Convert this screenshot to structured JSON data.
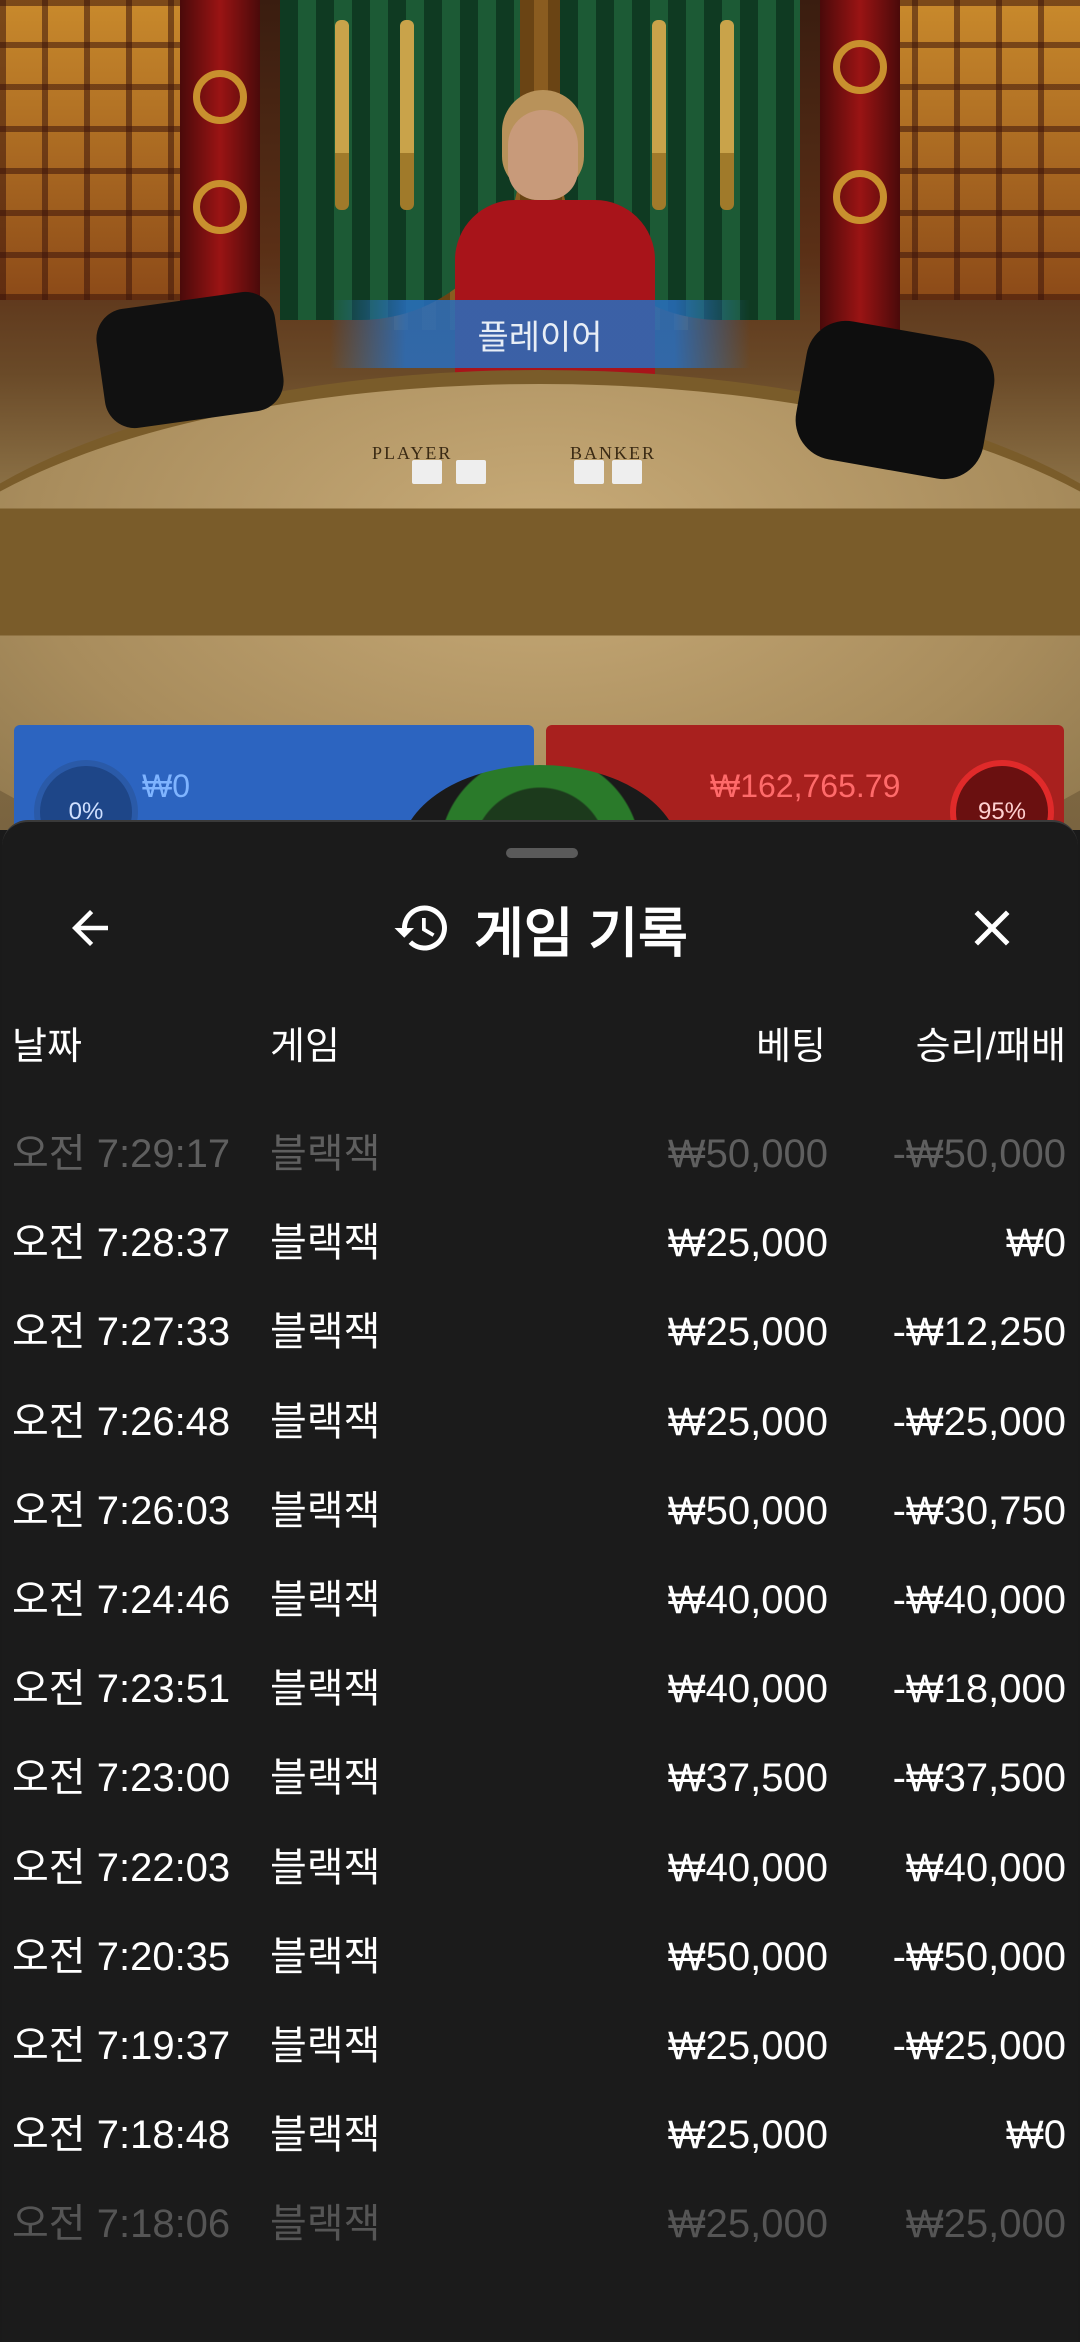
{
  "video": {
    "banner_label": "플레이어",
    "table_left_label": "PLAYER",
    "table_right_label": "BANKER",
    "player_percent": "0%",
    "player_amount": "₩0",
    "banker_amount": "₩162,765.79",
    "banker_percent": "95%"
  },
  "sheet": {
    "title": "게임 기록",
    "title_icon": "history-icon",
    "back_icon": "arrow-left-icon",
    "close_icon": "close-icon",
    "columns": {
      "date": "날짜",
      "game": "게임",
      "bet": "베팅",
      "result": "승리/패배"
    },
    "rows": [
      {
        "date": "오전 7:29:17",
        "game": "블랙잭",
        "bet": "₩50,000",
        "result": "-₩50,000"
      },
      {
        "date": "오전 7:28:37",
        "game": "블랙잭",
        "bet": "₩25,000",
        "result": "₩0"
      },
      {
        "date": "오전 7:27:33",
        "game": "블랙잭",
        "bet": "₩25,000",
        "result": "-₩12,250"
      },
      {
        "date": "오전 7:26:48",
        "game": "블랙잭",
        "bet": "₩25,000",
        "result": "-₩25,000"
      },
      {
        "date": "오전 7:26:03",
        "game": "블랙잭",
        "bet": "₩50,000",
        "result": "-₩30,750"
      },
      {
        "date": "오전 7:24:46",
        "game": "블랙잭",
        "bet": "₩40,000",
        "result": "-₩40,000"
      },
      {
        "date": "오전 7:23:51",
        "game": "블랙잭",
        "bet": "₩40,000",
        "result": "-₩18,000"
      },
      {
        "date": "오전 7:23:00",
        "game": "블랙잭",
        "bet": "₩37,500",
        "result": "-₩37,500"
      },
      {
        "date": "오전 7:22:03",
        "game": "블랙잭",
        "bet": "₩40,000",
        "result": "₩40,000"
      },
      {
        "date": "오전 7:20:35",
        "game": "블랙잭",
        "bet": "₩50,000",
        "result": "-₩50,000"
      },
      {
        "date": "오전 7:19:37",
        "game": "블랙잭",
        "bet": "₩25,000",
        "result": "-₩25,000"
      },
      {
        "date": "오전 7:18:48",
        "game": "블랙잭",
        "bet": "₩25,000",
        "result": "₩0"
      },
      {
        "date": "오전 7:18:06",
        "game": "블랙잭",
        "bet": "₩25,000",
        "result": "₩25,000"
      }
    ]
  }
}
